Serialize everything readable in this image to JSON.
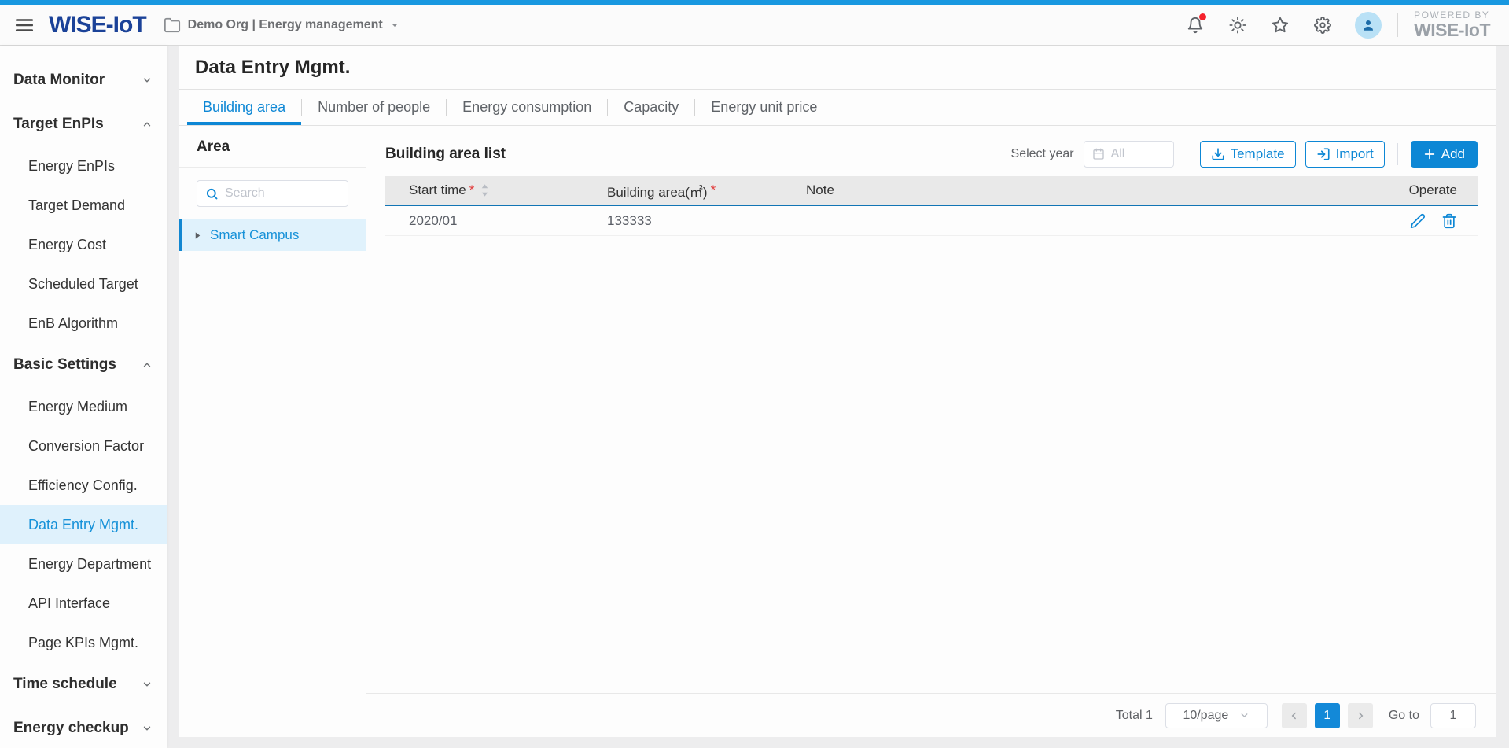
{
  "colors": {
    "accent": "#0d87d5",
    "top_strip": "#1898e0",
    "logo_navy": "#1b4298",
    "table_header_underline": "#1275b5",
    "selected_item_bg": "#dff1fc",
    "notification_dot": "#f5222d",
    "required_red": "#e23c3c"
  },
  "topbar": {
    "logo": "WISE-IoT",
    "org_label": "Demo Org | Energy management",
    "powered_by": "POWERED BY",
    "powered_brand": "WISE-IoT",
    "icons": [
      "hamburger-menu",
      "org-folder",
      "notification-bell",
      "brightness-sun",
      "favorite-star",
      "settings-gear",
      "user-avatar"
    ]
  },
  "sidebar": {
    "sections": [
      {
        "label": "Data Monitor",
        "expanded": false,
        "children": []
      },
      {
        "label": "Target EnPIs",
        "expanded": true,
        "children": [
          {
            "label": "Energy EnPIs"
          },
          {
            "label": "Target Demand"
          },
          {
            "label": "Energy Cost"
          },
          {
            "label": "Scheduled Target"
          },
          {
            "label": "EnB Algorithm"
          }
        ]
      },
      {
        "label": "Basic Settings",
        "expanded": true,
        "children": [
          {
            "label": "Energy Medium"
          },
          {
            "label": "Conversion Factor"
          },
          {
            "label": "Efficiency Config."
          },
          {
            "label": "Data Entry Mgmt.",
            "selected": true
          },
          {
            "label": "Energy Department"
          },
          {
            "label": "API Interface"
          },
          {
            "label": "Page KPIs Mgmt."
          }
        ]
      },
      {
        "label": "Time schedule",
        "expanded": false,
        "children": []
      },
      {
        "label": "Energy checkup",
        "expanded": false,
        "children": []
      }
    ]
  },
  "page": {
    "title": "Data Entry Mgmt.",
    "tabs": [
      {
        "label": "Building area",
        "active": true
      },
      {
        "label": "Number of people",
        "active": false
      },
      {
        "label": "Energy consumption",
        "active": false
      },
      {
        "label": "Capacity",
        "active": false
      },
      {
        "label": "Energy unit price",
        "active": false
      }
    ]
  },
  "area_panel": {
    "title": "Area",
    "search_placeholder": "Search",
    "tree": [
      {
        "label": "Smart Campus",
        "selected": true,
        "expander": "triangle-right"
      }
    ]
  },
  "list_panel": {
    "title": "Building area list",
    "select_year_label": "Select year",
    "select_year_value": "All",
    "template_button": "Template",
    "import_button": "Import",
    "add_button": "Add",
    "add_plus": "+",
    "table": {
      "required_mark": "*",
      "columns": {
        "start_time": "Start time",
        "building_area": "Building area(㎡)",
        "note": "Note",
        "operate": "Operate"
      },
      "rows": [
        {
          "start_time": "2020/01",
          "building_area": "133333",
          "note": ""
        }
      ]
    },
    "pagination": {
      "total": "Total 1",
      "page_size": "10/page",
      "current_page": "1",
      "goto_label": "Go to",
      "goto_value": "1"
    }
  }
}
